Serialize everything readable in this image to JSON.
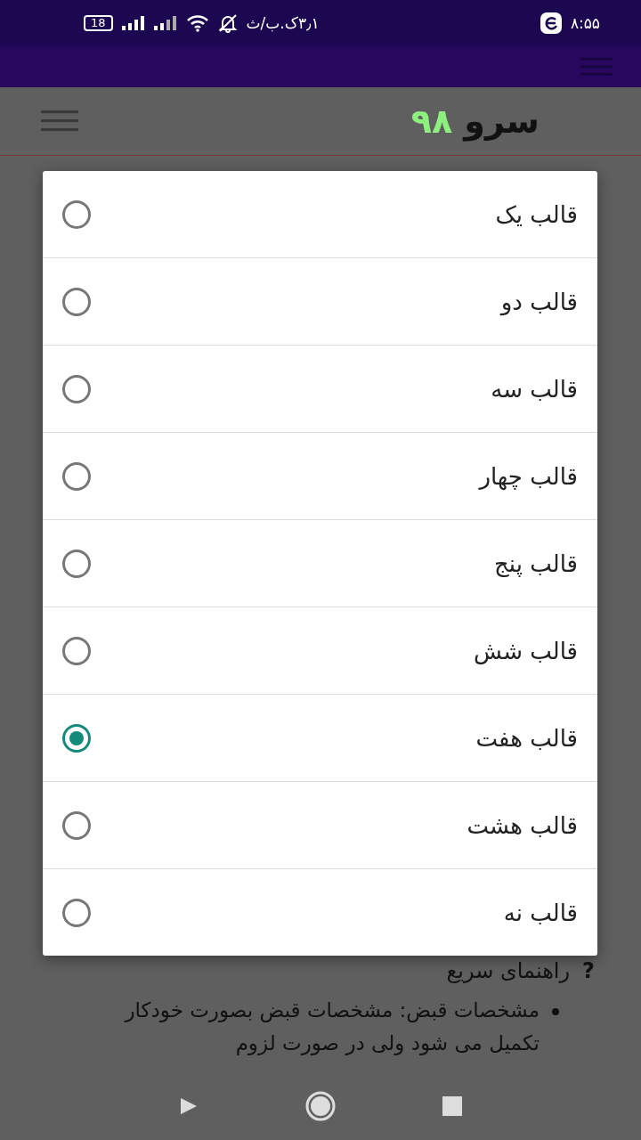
{
  "status_bar": {
    "time": "۸:۵۵",
    "speed": "۳٫۱ک.ب/ث",
    "battery": "18"
  },
  "header": {
    "logo_name": "سرو",
    "logo_number": "۹۸"
  },
  "dialog": {
    "options": [
      {
        "label": "قالب یک",
        "selected": false
      },
      {
        "label": "قالب دو",
        "selected": false
      },
      {
        "label": "قالب سه",
        "selected": false
      },
      {
        "label": "قالب چهار",
        "selected": false
      },
      {
        "label": "قالب پنج",
        "selected": false
      },
      {
        "label": "قالب شش",
        "selected": false
      },
      {
        "label": "قالب هفت",
        "selected": true
      },
      {
        "label": "قالب هشت",
        "selected": false
      },
      {
        "label": "قالب نه",
        "selected": false
      }
    ]
  },
  "help": {
    "icon": "?",
    "title": "راهنمای سریع",
    "items": [
      "مشخصات قبض: مشخصات قبض بصورت خودکار تکمیل می شود ولی در صورت لزوم"
    ]
  }
}
